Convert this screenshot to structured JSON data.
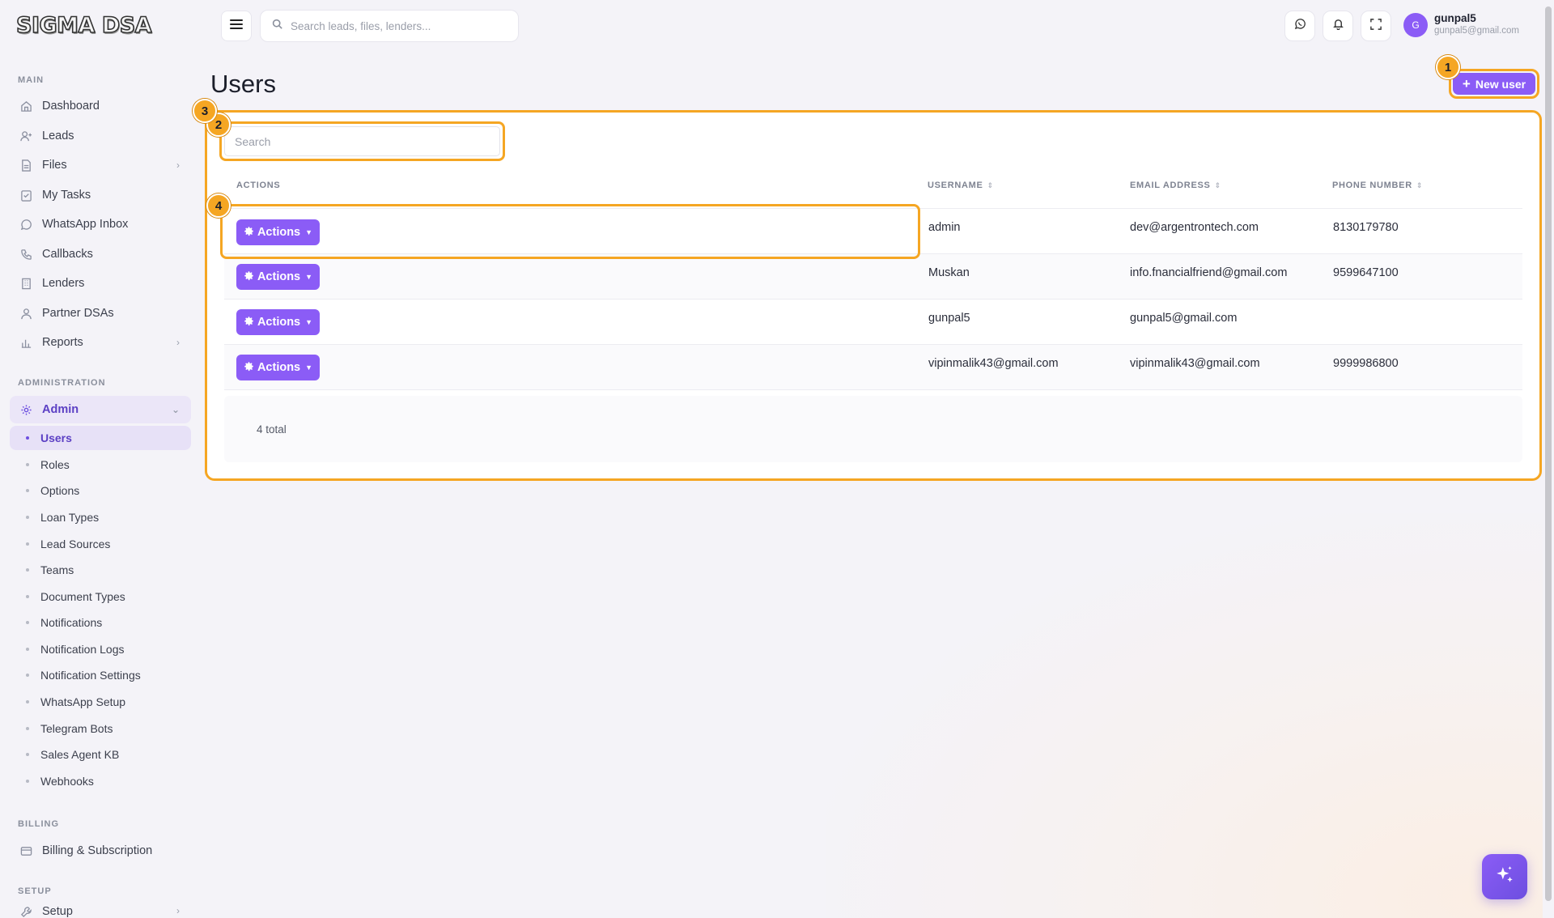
{
  "brand": {
    "logo_text": "SIGMA DSA"
  },
  "header": {
    "search_placeholder": "Search leads, files, lenders...",
    "user": {
      "initial": "G",
      "name": "gunpal5",
      "email": "gunpal5@gmail.com"
    }
  },
  "sidebar": {
    "sections": {
      "main": "MAIN",
      "administration": "ADMINISTRATION",
      "billing": "BILLING",
      "setup": "SETUP"
    },
    "main_items": [
      {
        "label": "Dashboard",
        "icon": "home-icon"
      },
      {
        "label": "Leads",
        "icon": "user-plus-icon"
      },
      {
        "label": "Files",
        "icon": "file-icon"
      },
      {
        "label": "My Tasks",
        "icon": "clipboard-icon"
      },
      {
        "label": "WhatsApp Inbox",
        "icon": "whatsapp-icon"
      },
      {
        "label": "Callbacks",
        "icon": "phone-icon"
      },
      {
        "label": "Lenders",
        "icon": "building-icon"
      },
      {
        "label": "Partner DSAs",
        "icon": "users-icon"
      },
      {
        "label": "Reports",
        "icon": "bar-chart-icon"
      }
    ],
    "admin": {
      "label": "Admin",
      "sub_items": [
        "Users",
        "Roles",
        "Options",
        "Loan Types",
        "Lead Sources",
        "Teams",
        "Document Types",
        "Notifications",
        "Notification Logs",
        "Notification Settings",
        "WhatsApp Setup",
        "Telegram Bots",
        "Sales Agent KB",
        "Webhooks"
      ]
    },
    "billing_item": "Billing & Subscription",
    "setup_item": "Setup"
  },
  "page": {
    "title": "Users",
    "new_user_label": "New user",
    "search_placeholder": "Search",
    "columns": {
      "actions": "ACTIONS",
      "username": "USERNAME",
      "email": "EMAIL ADDRESS",
      "phone": "PHONE NUMBER"
    },
    "action_label": "Actions",
    "rows": [
      {
        "username": "admin",
        "email": "dev@argentrontech.com",
        "phone": "8130179780"
      },
      {
        "username": "Muskan",
        "email": "info.fnancialfriend@gmail.com",
        "phone": "9599647100"
      },
      {
        "username": "gunpal5",
        "email": "gunpal5@gmail.com",
        "phone": ""
      },
      {
        "username": "vipinmalik43@gmail.com",
        "email": "vipinmalik43@gmail.com",
        "phone": "9999986800"
      }
    ],
    "total_text": "4 total"
  },
  "annotations": [
    "1",
    "2",
    "3",
    "4"
  ],
  "colors": {
    "accent": "#8b5cf6",
    "highlight": "#f5a623",
    "active_bg": "#ebe6f8"
  }
}
